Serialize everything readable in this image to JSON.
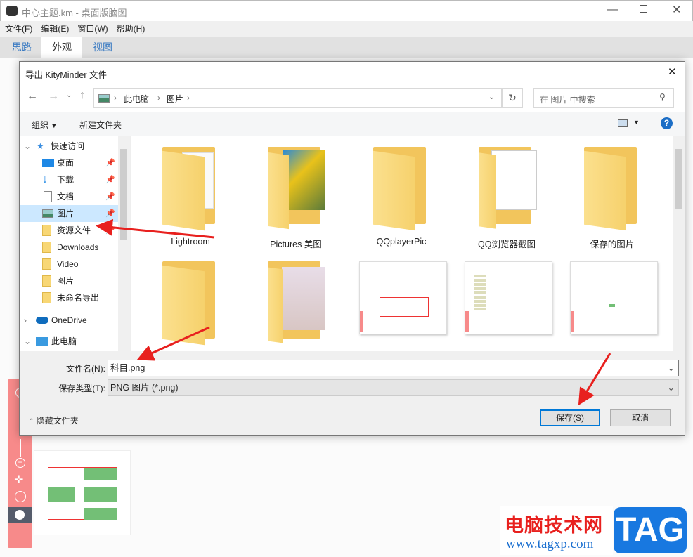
{
  "app": {
    "title": "中心主题.km - 桌面版脑图",
    "menu": [
      "文件(F)",
      "编辑(E)",
      "窗口(W)",
      "帮助(H)"
    ],
    "tabs": [
      "思路",
      "外观",
      "视图"
    ],
    "active_tab": "外观",
    "window_controls": [
      "minimize-icon",
      "maximize-icon",
      "close-icon"
    ]
  },
  "dialog": {
    "title": "导出 KityMinder 文件",
    "breadcrumb": [
      "此电脑",
      "图片"
    ],
    "search_placeholder": "在 图片 中搜索",
    "toolbar": {
      "organize": "组织",
      "new_folder": "新建文件夹"
    },
    "nav": {
      "quick_access": "快速访问",
      "items": [
        {
          "label": "桌面",
          "pinned": true
        },
        {
          "label": "下载",
          "pinned": true
        },
        {
          "label": "文档",
          "pinned": true
        },
        {
          "label": "图片",
          "pinned": true,
          "selected": true
        },
        {
          "label": "资源文件",
          "pinned": true
        },
        {
          "label": "Downloads"
        },
        {
          "label": "Video"
        },
        {
          "label": "图片"
        },
        {
          "label": "未命名导出"
        }
      ],
      "onedrive": "OneDrive",
      "this_pc": "此电脑"
    },
    "files": [
      "Lightroom",
      "Pictures 美图",
      "QQplayerPic",
      "QQ浏览器截图",
      "保存的图片"
    ],
    "filename_label": "文件名(N):",
    "filename": "科目.png",
    "type_label": "保存类型(T):",
    "type": "PNG 图片 (*.png)",
    "hide_folders": "隐藏文件夹",
    "save": "保存(S)",
    "cancel": "取消"
  },
  "watermark": {
    "text": "电脑技术网",
    "url": "www.tagxp.com",
    "tag": "TAG"
  },
  "colors": {
    "accent": "#0078d7",
    "arrow": "#e8201e",
    "toolbar_red": "#f78a8a",
    "node_green": "#73bf76"
  }
}
